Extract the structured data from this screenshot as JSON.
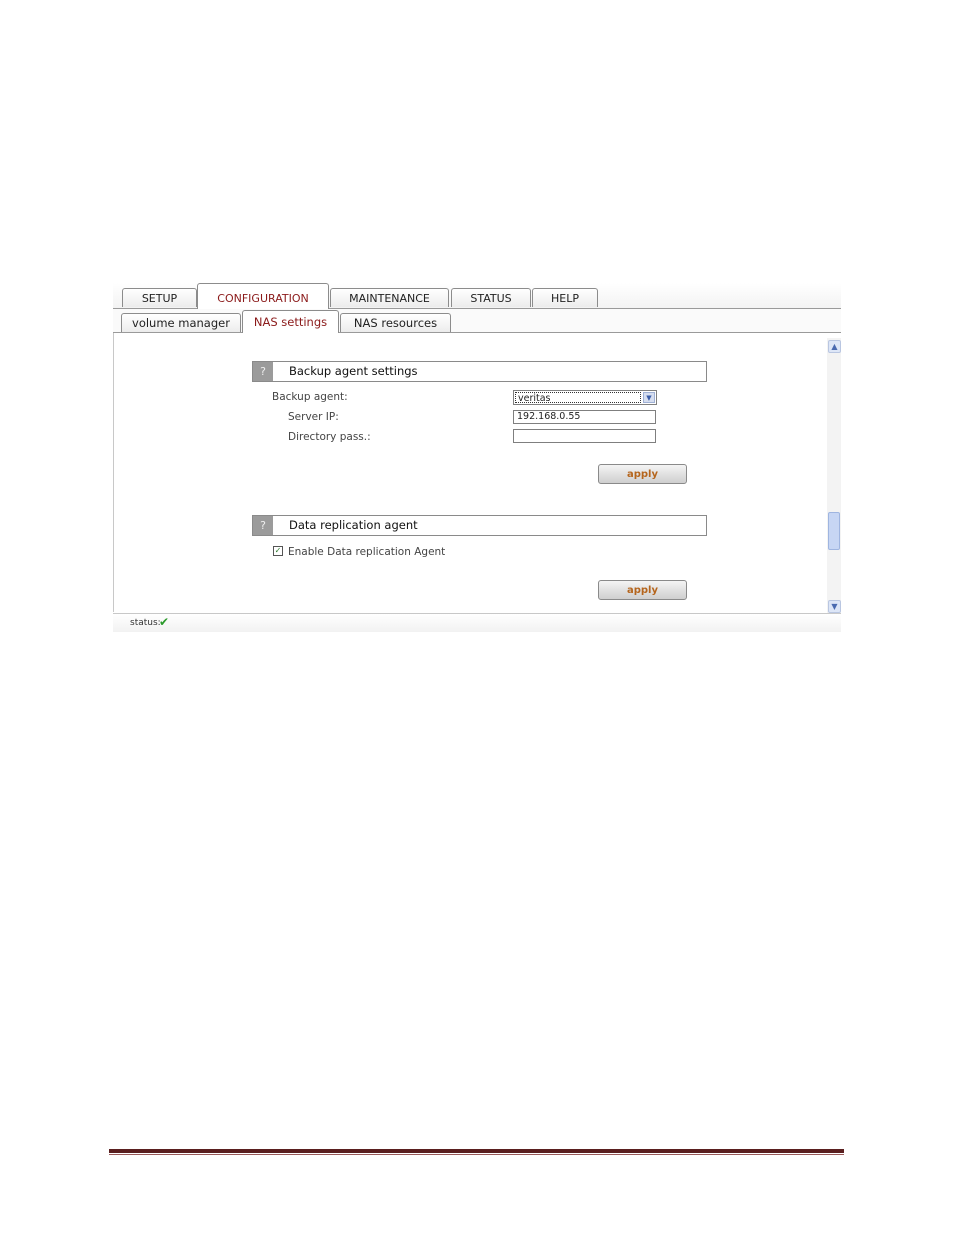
{
  "top_tabs": [
    {
      "label": "SETUP",
      "active": false
    },
    {
      "label": "CONFIGURATION",
      "active": true
    },
    {
      "label": "MAINTENANCE",
      "active": false
    },
    {
      "label": "STATUS",
      "active": false
    },
    {
      "label": "HELP",
      "active": false
    }
  ],
  "sub_tabs": [
    {
      "label": "volume manager",
      "active": false
    },
    {
      "label": "NAS settings",
      "active": true
    },
    {
      "label": "NAS resources",
      "active": false
    }
  ],
  "backup_panel": {
    "help_symbol": "?",
    "title": "Backup agent settings",
    "backup_agent_label": "Backup agent:",
    "backup_agent_value": "veritas",
    "server_ip_label": "Server IP:",
    "server_ip_value": "192.168.0.55",
    "directory_pass_label": "Directory pass.:",
    "directory_pass_value": "",
    "apply_label": "apply"
  },
  "replication_panel": {
    "help_symbol": "?",
    "title": "Data replication agent",
    "enable_label": "Enable Data replication Agent",
    "enable_checked": true,
    "apply_label": "apply"
  },
  "status_bar": {
    "label": "status:",
    "icon": "check-icon"
  },
  "colors": {
    "active_tab_text": "#8b1a1a",
    "apply_text": "#b5651d",
    "footer_rule": "#5a1f1f"
  }
}
